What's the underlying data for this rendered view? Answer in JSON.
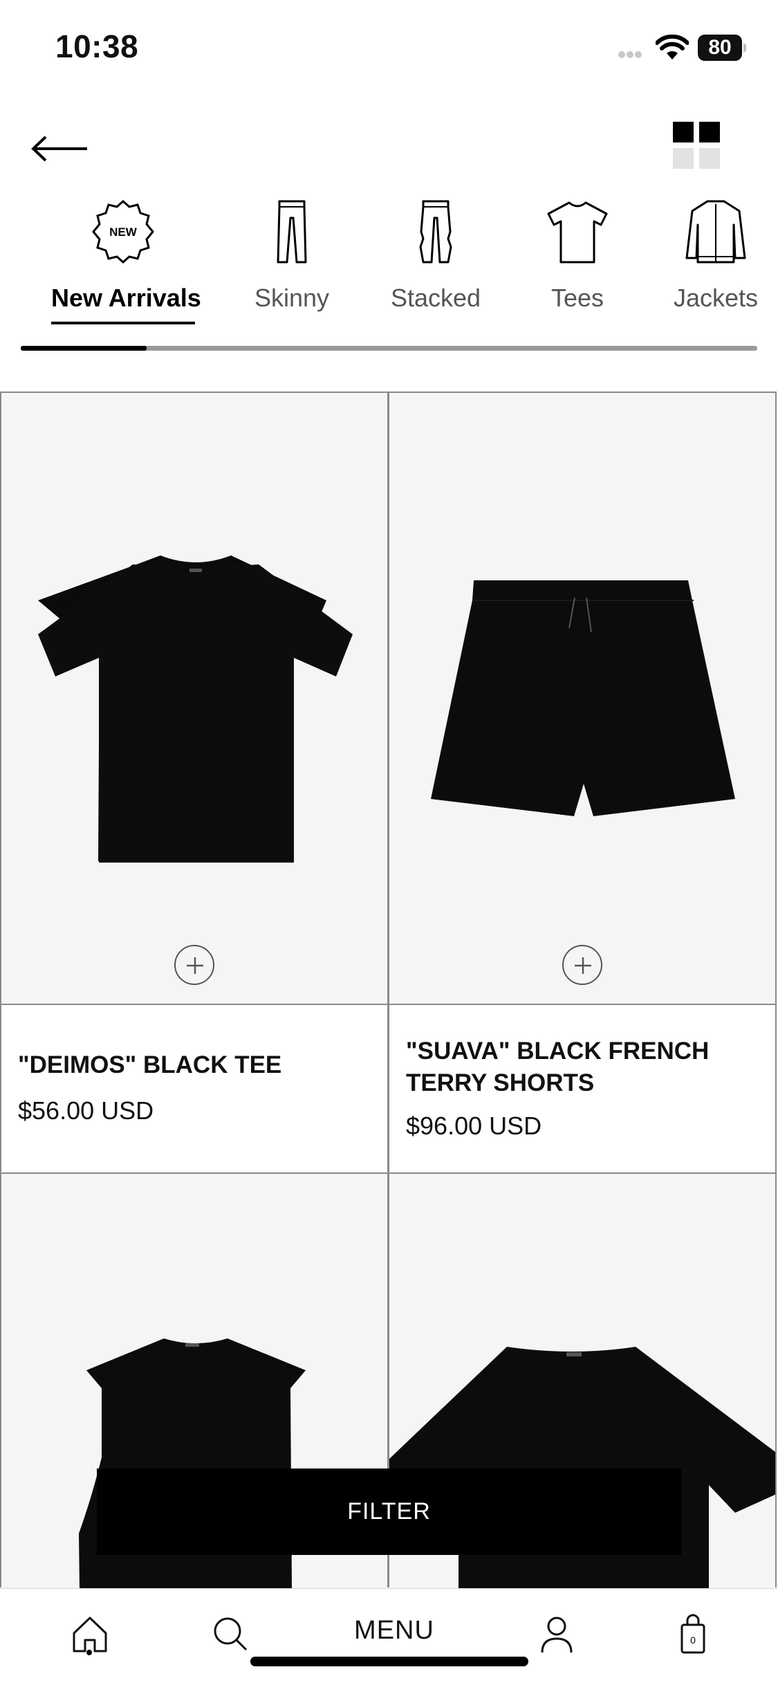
{
  "status_bar": {
    "time": "10:38",
    "battery": "80"
  },
  "categories": [
    {
      "label": "New Arrivals",
      "icon": "new-badge-icon",
      "badge_text": "NEW",
      "active": true
    },
    {
      "label": "Skinny",
      "icon": "skinny-pants-icon"
    },
    {
      "label": "Stacked",
      "icon": "stacked-pants-icon"
    },
    {
      "label": "Tees",
      "icon": "tshirt-icon"
    },
    {
      "label": "Jackets",
      "icon": "jacket-icon"
    }
  ],
  "products": [
    {
      "name": "\"DEIMOS\" BLACK TEE",
      "price": "$56.00 USD"
    },
    {
      "name": "\"SUAVA\" BLACK FRENCH TERRY SHORTS",
      "price": "$96.00 USD"
    },
    {
      "name": "",
      "price": ""
    },
    {
      "name": "",
      "price": ""
    }
  ],
  "filter": {
    "label": "FILTER"
  },
  "tab_bar": {
    "menu_label": "MENU",
    "cart_count": "0"
  },
  "colors": {
    "accent": "#000000",
    "image_bg": "#f5f5f5",
    "border": "#8a8a8a"
  }
}
